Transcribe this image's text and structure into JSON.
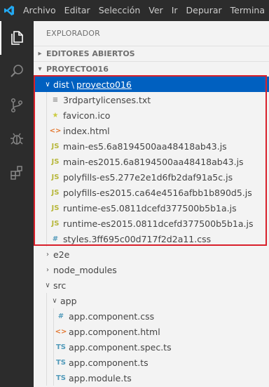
{
  "menu": [
    "Archivo",
    "Editar",
    "Selección",
    "Ver",
    "Ir",
    "Depurar",
    "Termina"
  ],
  "activity_icons": [
    "files-icon",
    "search-icon",
    "source-control-icon",
    "debug-icon",
    "extensions-icon"
  ],
  "explorer": {
    "title": "EXPLORADOR",
    "open_editors": "EDITORES ABIERTOS",
    "project": "PROYECTO016"
  },
  "tree": {
    "dist_folder": "dist",
    "dist_sep": "\\",
    "dist_link": "proyecto016",
    "dist_files": [
      {
        "icon": "txt",
        "glyph": "≡",
        "name": "3rdpartylicenses.txt"
      },
      {
        "icon": "star",
        "glyph": "★",
        "name": "favicon.ico"
      },
      {
        "icon": "html",
        "glyph": "<>",
        "name": "index.html"
      },
      {
        "icon": "js",
        "glyph": "JS",
        "name": "main-es5.6a8194500aa48418ab43.js"
      },
      {
        "icon": "js",
        "glyph": "JS",
        "name": "main-es2015.6a8194500aa48418ab43.js"
      },
      {
        "icon": "js",
        "glyph": "JS",
        "name": "polyfills-es5.277e2e1d6fb2daf91a5c.js"
      },
      {
        "icon": "js",
        "glyph": "JS",
        "name": "polyfills-es2015.ca64e4516afbb1b890d5.js"
      },
      {
        "icon": "js",
        "glyph": "JS",
        "name": "runtime-es5.0811dcefd377500b5b1a.js"
      },
      {
        "icon": "js",
        "glyph": "JS",
        "name": "runtime-es2015.0811dcefd377500b5b1a.js"
      },
      {
        "icon": "css",
        "glyph": "#",
        "name": "styles.3ff695c00d717f2d2a11.css"
      }
    ],
    "e2e": "e2e",
    "node_modules": "node_modules",
    "src": "src",
    "app": "app",
    "app_files": [
      {
        "icon": "css",
        "glyph": "#",
        "name": "app.component.css"
      },
      {
        "icon": "html",
        "glyph": "<>",
        "name": "app.component.html"
      },
      {
        "icon": "ts",
        "glyph": "TS",
        "name": "app.component.spec.ts"
      },
      {
        "icon": "ts",
        "glyph": "TS",
        "name": "app.component.ts"
      },
      {
        "icon": "ts",
        "glyph": "TS",
        "name": "app.module.ts"
      }
    ]
  },
  "colors": {
    "selection": "#0060c0",
    "highlight_border": "#d9202b",
    "activity_bar": "#2c2c2c",
    "sidebar": "#f3f3f3"
  }
}
